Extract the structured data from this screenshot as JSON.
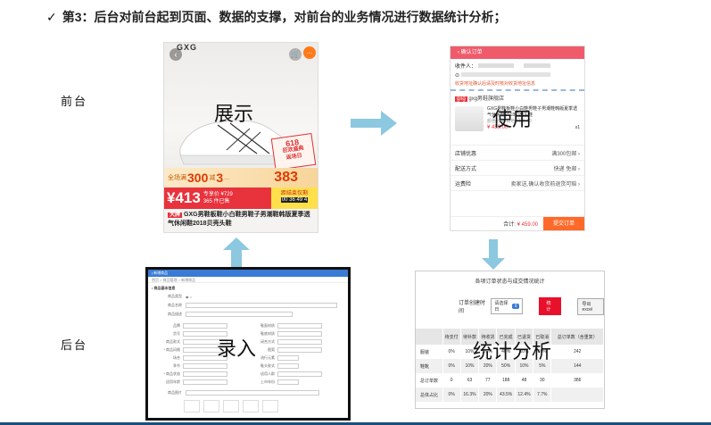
{
  "heading": {
    "check": "✓",
    "text": "第3：后台对前台起到页面、数据的支撑，对前台的业务情况进行数据统计分析；"
  },
  "labels": {
    "frontend": "前台",
    "backend": "后台"
  },
  "overlays": {
    "display": "展示",
    "use": "使用",
    "entry": "录入",
    "stats": "统计分析"
  },
  "colors": {
    "arrow": "#8cc8e0",
    "accent_red": "#e8323c",
    "admin_blue": "#3a7bd5"
  },
  "product": {
    "logo": "GXG",
    "back_icon": "‹",
    "cart_icon": "🛒",
    "more_icon": "…",
    "badge": [
      "618",
      "狂欢盛典",
      "返场日"
    ],
    "promo": {
      "prefix": "全场满",
      "amount1": "300",
      "mid": "减",
      "amount2": "3",
      "suffix": "...",
      "price_tag": "383"
    },
    "price": "¥413",
    "price_note": [
      "专享价 ¥729",
      "365 件已售"
    ],
    "countdown_title": "距结束仅剩",
    "countdown": "00 36 49 4",
    "tag": "大牌",
    "title": "GXG男鞋板鞋小白鞋男鞋子男潮鞋韩版夏季透气休闲鞋2018贝壳头鞋"
  },
  "order": {
    "topbar": "‹ 确认订单",
    "receiver_label": "收件人：",
    "address_hint": "收货地址确认后请及时核对收货地址信息",
    "store_tag": "gxg",
    "store_name": "gxg男鞋旗舰店",
    "goods_title": "GXG男鞋板鞋小白鞋男鞋子男潮鞋韩版夏季透气休闲鞋2018贝壳头鞋",
    "goods_spec": "颜色分类:白色 尺码:40",
    "goods_price": "¥ 459.00",
    "goods_qty": "x1",
    "rows": [
      {
        "label": "店铺优惠",
        "value": "满300包邮 ›"
      },
      {
        "label": "配送方式",
        "value": "快递 免邮 ›"
      },
      {
        "label": "运费险",
        "value": "卖家送,确认收货前退货可赔 ›"
      }
    ],
    "total_label": "合计:",
    "total_value": "¥ 459.00",
    "submit": "提交订单"
  },
  "admin": {
    "bar": "| 新增商品",
    "crumbs": "首页 > 商品管理 > 新增商品",
    "section": "• 商品基本信息",
    "rows": [
      "商品类型",
      "商品名称",
      "商品描述"
    ],
    "col_left": [
      "品牌",
      "货号",
      "商品款式",
      "* 商品风格",
      "场合",
      "季节",
      "* 商品状态",
      "适用年龄"
    ],
    "col_right": [
      "鞋面材质",
      "鞋底材质",
      "闭合方式",
      "图案",
      "流行元素",
      "鞋头款式",
      "适用人群",
      "上市年份"
    ],
    "bottom_label": "商品图片"
  },
  "stats": {
    "title": "各项订单状态与成交情况统计",
    "time_label": "订单创建时间",
    "select_value": "请选择日",
    "stat_button": "统计",
    "export_button": "导出excel",
    "headers": [
      "",
      "待支付",
      "待补款",
      "待收货",
      "已完成",
      "已退货",
      "已取消",
      "总订单数（含重复）"
    ],
    "rows": [
      [
        "服装",
        "0%",
        "10%",
        "20%",
        "40%",
        "10%",
        "10%",
        "242"
      ],
      [
        "鞋靴",
        "0%",
        "10%",
        "20%",
        "50%",
        "10%",
        "5%",
        "144"
      ],
      [
        "总订单数",
        "0",
        "63",
        "77",
        "188",
        "48",
        "30",
        "386"
      ],
      [
        "总体占比",
        "0%",
        "16.3%",
        "20%",
        "43.5%",
        "12.4%",
        "7.7%",
        ""
      ]
    ]
  }
}
